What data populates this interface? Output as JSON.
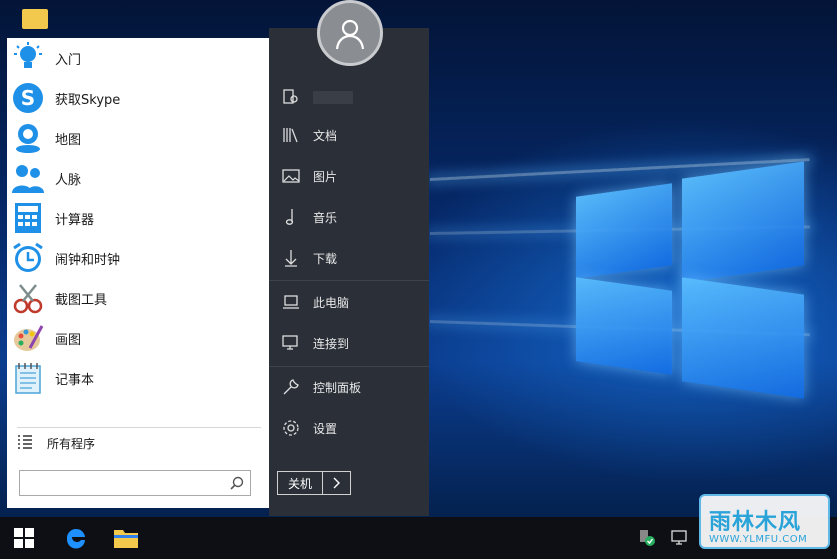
{
  "start_menu": {
    "apps": [
      {
        "label": "入门",
        "icon": "lightbulb-icon"
      },
      {
        "label": "获取Skype",
        "icon": "skype-icon"
      },
      {
        "label": "地图",
        "icon": "maps-icon"
      },
      {
        "label": "人脉",
        "icon": "people-icon"
      },
      {
        "label": "计算器",
        "icon": "calculator-icon"
      },
      {
        "label": "闹钟和时钟",
        "icon": "alarm-clock-icon"
      },
      {
        "label": "截图工具",
        "icon": "snipping-tool-icon"
      },
      {
        "label": "画图",
        "icon": "paint-icon"
      },
      {
        "label": "记事本",
        "icon": "notepad-icon"
      }
    ],
    "all_programs": "所有程序",
    "search": {
      "value": "",
      "placeholder": ""
    },
    "places": {
      "user": {
        "icon": "user-folder-icon"
      },
      "documents": "文档",
      "pictures": "图片",
      "music": "音乐",
      "downloads": "下载",
      "this_pc": "此电脑",
      "connect": "连接到",
      "control_panel": "控制面板",
      "settings": "设置"
    },
    "shutdown_label": "关机"
  },
  "watermark": {
    "title": "雨林木风",
    "url": "WWW.YLMFU.COM"
  },
  "colors": {
    "accent": "#1e90ff",
    "menu_right_bg": "#2b3038",
    "taskbar_bg": "#0d0f14"
  }
}
